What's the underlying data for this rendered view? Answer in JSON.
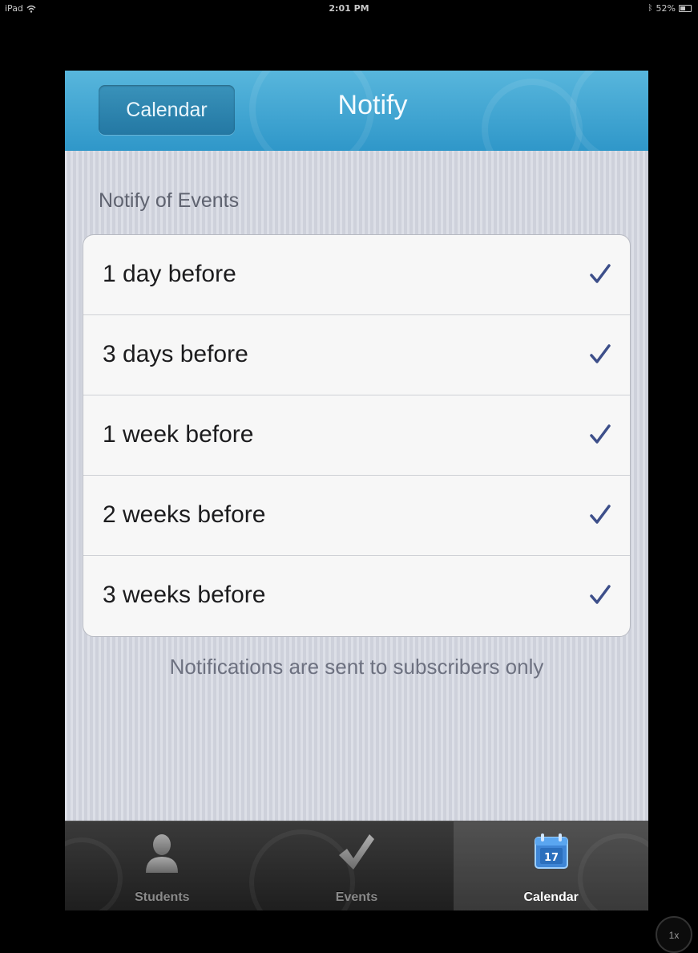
{
  "status_bar": {
    "device": "iPad",
    "time": "2:01 PM",
    "battery": "52%"
  },
  "nav": {
    "back_label": "Calendar",
    "title": "Notify"
  },
  "section_header": "Notify of Events",
  "options": [
    {
      "label": "1 day before",
      "checked": true
    },
    {
      "label": "3 days before",
      "checked": true
    },
    {
      "label": "1 week before",
      "checked": true
    },
    {
      "label": "2 weeks before",
      "checked": true
    },
    {
      "label": "3 weeks before",
      "checked": true
    }
  ],
  "footer_note": "Notifications are sent to subscribers only",
  "tabs": [
    {
      "label": "Students",
      "icon": "person-icon",
      "active": false
    },
    {
      "label": "Events",
      "icon": "checkmark-icon",
      "active": false
    },
    {
      "label": "Calendar",
      "icon": "calendar-icon",
      "active": true,
      "icon_text": "17"
    }
  ],
  "zoom_badge": "1x",
  "colors": {
    "nav_blue": "#3a9fd0",
    "check_blue": "#3d4f8a",
    "calendar_icon_blue": "#3f86d6"
  }
}
